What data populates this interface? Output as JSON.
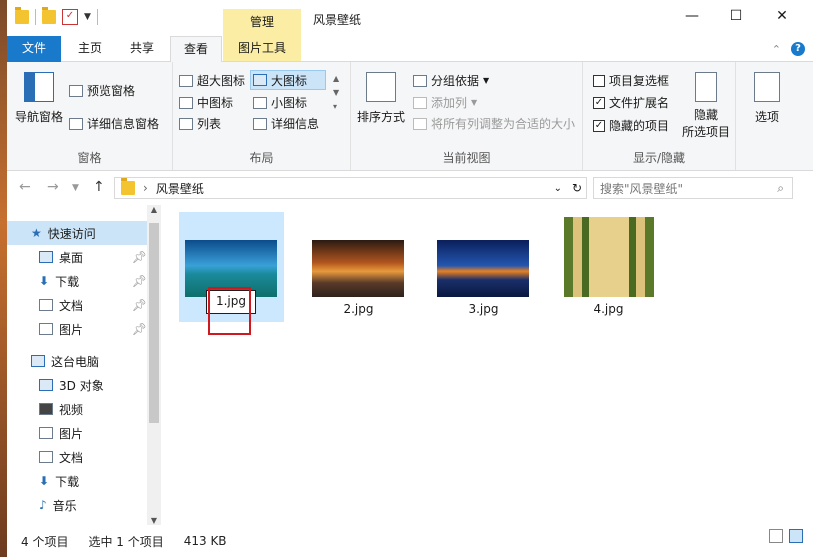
{
  "window": {
    "title": "风景壁纸",
    "context_tab": "管理"
  },
  "tabs": [
    {
      "label": "文件"
    },
    {
      "label": "主页"
    },
    {
      "label": "共享"
    },
    {
      "label": "查看"
    },
    {
      "label": "图片工具"
    }
  ],
  "ribbon": {
    "pane_group": {
      "label": "窗格",
      "nav_pane": "导航窗格",
      "preview_pane": "预览窗格",
      "details_pane": "详细信息窗格"
    },
    "layout_group": {
      "label": "布局",
      "items": [
        "超大图标",
        "大图标",
        "中图标",
        "小图标",
        "列表",
        "详细信息"
      ]
    },
    "current_view_group": {
      "label": "当前视图",
      "sort": "排序方式",
      "group_by": "分组依据",
      "add_columns": "添加列",
      "fit_columns": "将所有列调整为合适的大小"
    },
    "show_hide_group": {
      "label": "显示/隐藏",
      "item_checkboxes": "项目复选框",
      "file_extensions": "文件扩展名",
      "hidden_items": "隐藏的项目",
      "hide_selected": "隐藏",
      "hide_selected_2": "所选项目"
    },
    "options": "选项"
  },
  "address": {
    "path": "风景壁纸",
    "search_placeholder": "搜索\"风景壁纸\""
  },
  "nav_pane": {
    "quick_access": "快速访问",
    "quick_items": [
      "桌面",
      "下载",
      "文档",
      "图片"
    ],
    "this_pc": "这台电脑",
    "pc_items": [
      "3D 对象",
      "视频",
      "图片",
      "文档",
      "下载",
      "音乐"
    ]
  },
  "files": [
    {
      "name": "1.jpg"
    },
    {
      "name": "2.jpg"
    },
    {
      "name": "3.jpg"
    },
    {
      "name": "4.jpg"
    }
  ],
  "status": {
    "count": "4 个项目",
    "selected": "选中 1 个项目",
    "size": "413 KB"
  },
  "colors": {
    "accent": "#1979ca",
    "selection": "#cce8ff",
    "context_tab": "#fbeea4",
    "highlight_box": "#d0191f"
  }
}
